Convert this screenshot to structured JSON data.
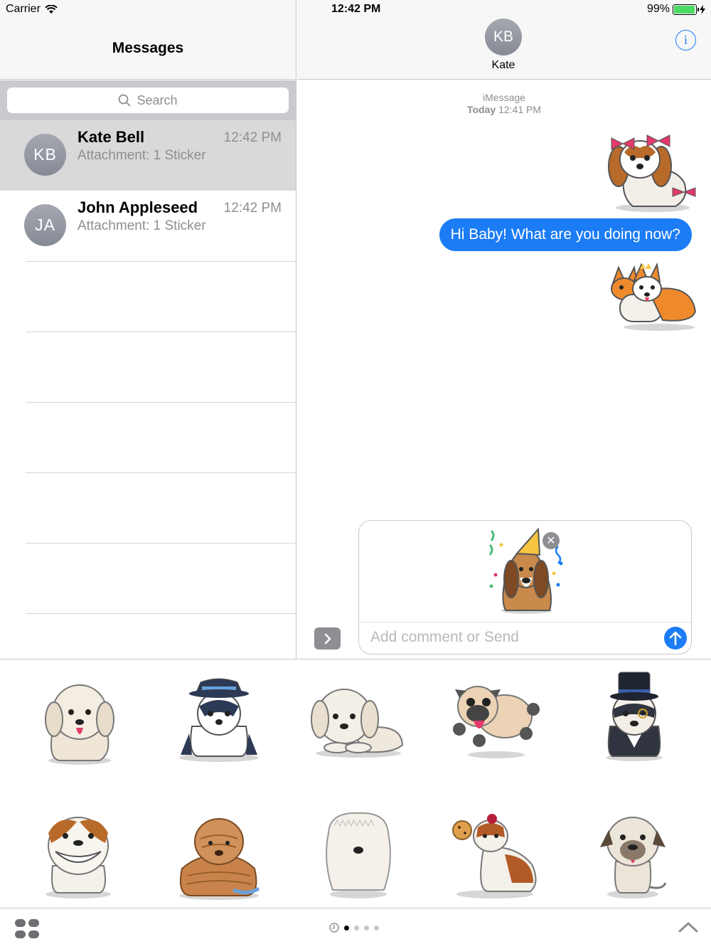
{
  "status": {
    "carrier": "Carrier",
    "time": "12:42 PM",
    "battery": "99%"
  },
  "left": {
    "title": "Messages",
    "search_placeholder": "Search",
    "conversations": [
      {
        "initials": "KB",
        "name": "Kate Bell",
        "preview": "Attachment: 1 Sticker",
        "time": "12:42 PM"
      },
      {
        "initials": "JA",
        "name": "John Appleseed",
        "preview": "Attachment: 1 Sticker",
        "time": "12:42 PM"
      }
    ]
  },
  "chat": {
    "contact_initials": "KB",
    "contact_name": "Kate",
    "service": "iMessage",
    "date_day": "Today",
    "date_time": "12:41 PM",
    "message": "Hi Baby! What are you doing now?",
    "compose_placeholder": "Add comment or Send"
  },
  "colors": {
    "accent": "#1b7cf5",
    "battery": "#4cd964",
    "selected_row": "#d9d9d9"
  },
  "icons": [
    "wifi-icon",
    "battery-icon",
    "info-icon",
    "search-icon",
    "send-icon",
    "expand-icon",
    "apps-icon",
    "recents-icon",
    "chevron-up-icon"
  ],
  "pager": {
    "pages": 4,
    "current": 1
  }
}
